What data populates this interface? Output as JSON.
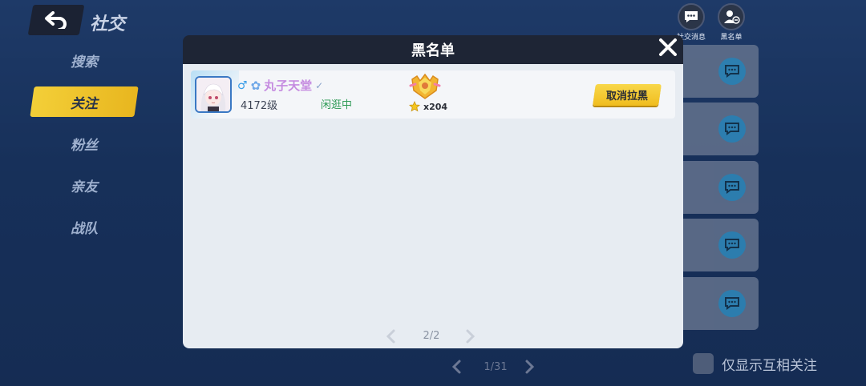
{
  "header": {
    "title": "社交"
  },
  "nav": {
    "items": [
      {
        "label": "搜索",
        "active": false
      },
      {
        "label": "关注",
        "active": true
      },
      {
        "label": "粉丝",
        "active": false
      },
      {
        "label": "亲友",
        "active": false
      },
      {
        "label": "战队",
        "active": false
      }
    ]
  },
  "top_icons": [
    {
      "icon": "chat-icon",
      "label": "社交消息"
    },
    {
      "icon": "blacklist-user-icon",
      "label": "黑名单"
    }
  ],
  "background_pager": {
    "label": "1/31"
  },
  "mutual_filter": {
    "label": "仅显示互相关注",
    "checked": false
  },
  "modal": {
    "title": "黑名单",
    "rows": [
      {
        "name": "丸子天堂",
        "gender_symbol": "♂",
        "level": "4172级",
        "status": "闲逛中",
        "star_count": "x204",
        "button_label": "取消拉黑"
      }
    ],
    "pager": {
      "label": "2/2"
    }
  },
  "colors": {
    "accent_yellow": "#f3cf38",
    "modal_header": "#1e2535",
    "modal_body": "#e7ecf2",
    "status_green": "#2e9a55",
    "name_purple": "#c58be0"
  }
}
